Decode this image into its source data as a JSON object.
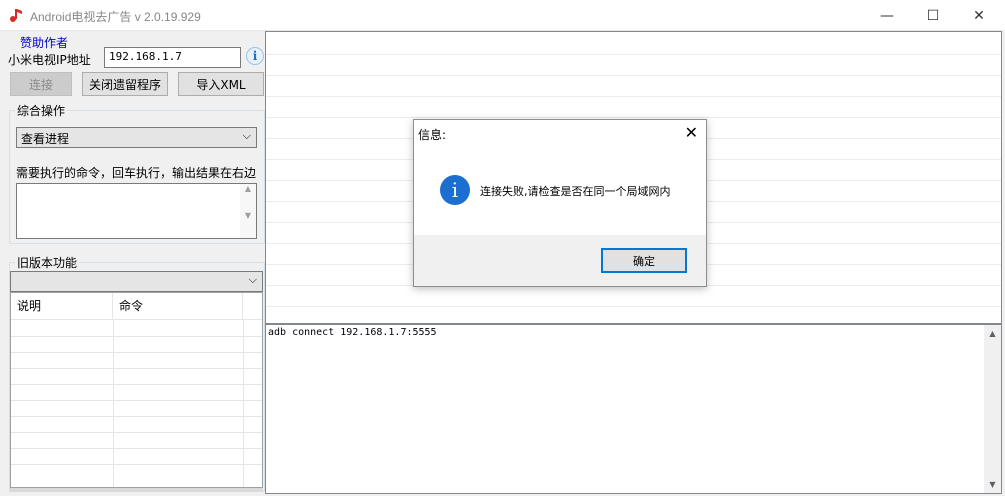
{
  "window": {
    "title": "Android电视去广告 v 2.0.19.929",
    "minimize": "—",
    "maximize": "☐",
    "close": "✕"
  },
  "left": {
    "sponsor_link": "赞助作者",
    "ip_label": "小米电视IP地址",
    "ip_value": "192.168.1.7",
    "info_glyph": "i",
    "buttons": {
      "connect": "连接",
      "close_residual": "关闭遗留程序",
      "import_xml": "导入XML"
    },
    "general_ops": {
      "title": "综合操作",
      "selected": "查看进程",
      "cmd_hint": "需要执行的命令，回车执行，输出结果在右边"
    },
    "legacy": {
      "title": "旧版本功能",
      "selected": "",
      "columns": [
        "说明",
        "命令"
      ]
    }
  },
  "output": {
    "text": "adb connect 192.168.1.7:5555"
  },
  "dialog": {
    "title": "信息:",
    "message": "连接失败,请检查是否在同一个局域网内",
    "ok": "确定"
  },
  "icons": {
    "app": "music-note-icon",
    "info": "info-icon",
    "chevron": "chevron-down-icon"
  },
  "colors": {
    "link": "#0000cc",
    "info_blue": "#1d6fcf",
    "focus_border": "#0078d7"
  }
}
